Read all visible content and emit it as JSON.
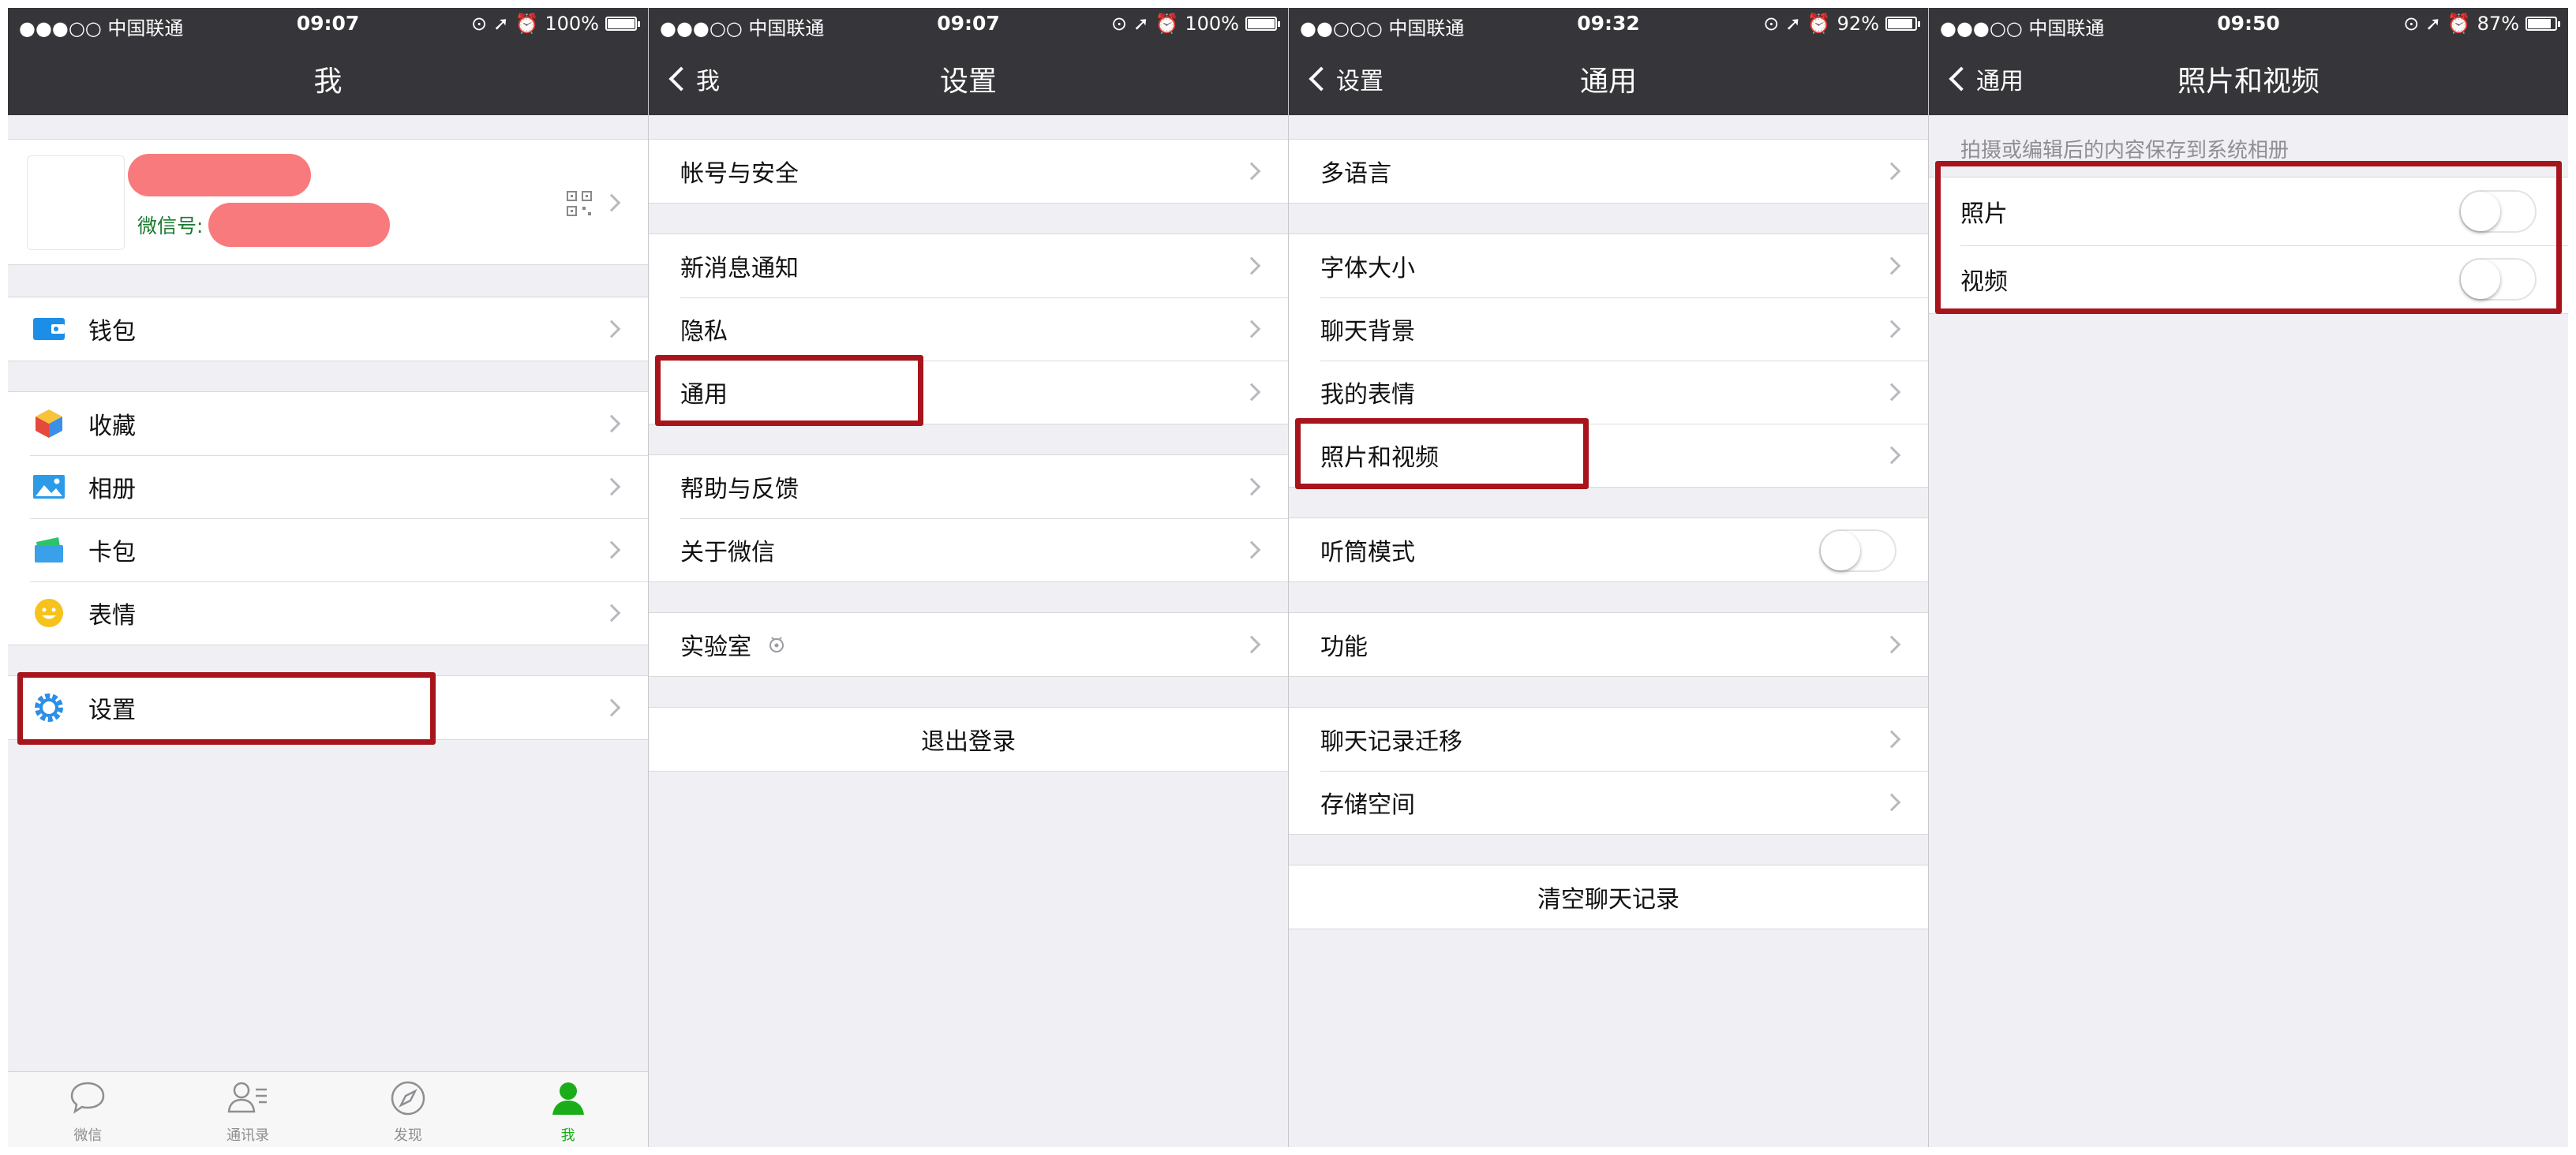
{
  "panels": [
    {
      "status": {
        "carrier": "●●●○○ 中国联通",
        "time": "09:07",
        "battery": "100%",
        "battery_level": 1.0
      },
      "title": "我",
      "profile": {
        "wechat_id_label": "微信号:"
      },
      "items": [
        {
          "label": "钱包",
          "icon": "wallet-icon"
        },
        {
          "label": "收藏",
          "icon": "favorites-icon"
        },
        {
          "label": "相册",
          "icon": "album-icon"
        },
        {
          "label": "卡包",
          "icon": "card-pack-icon"
        },
        {
          "label": "表情",
          "icon": "sticker-icon"
        },
        {
          "label": "设置",
          "icon": "settings-gear-icon"
        }
      ],
      "tabs": [
        {
          "label": "微信",
          "icon": "chat-bubble-icon"
        },
        {
          "label": "通讯录",
          "icon": "contacts-icon"
        },
        {
          "label": "发现",
          "icon": "compass-icon"
        },
        {
          "label": "我",
          "icon": "person-icon"
        }
      ]
    },
    {
      "status": {
        "carrier": "●●●○○ 中国联通",
        "time": "09:07",
        "battery": "100%",
        "battery_level": 1.0
      },
      "back": "我",
      "title": "设置",
      "items": [
        "帐号与安全",
        "新消息通知",
        "隐私",
        "通用",
        "帮助与反馈",
        "关于微信",
        "实验室"
      ],
      "logout": "退出登录"
    },
    {
      "status": {
        "carrier": "●●○○○ 中国联通",
        "time": "09:32",
        "battery": "92%",
        "battery_level": 0.92
      },
      "back": "设置",
      "title": "通用",
      "items": [
        "多语言",
        "字体大小",
        "聊天背景",
        "我的表情",
        "照片和视频",
        "听筒模式",
        "功能",
        "聊天记录迁移",
        "存储空间"
      ],
      "clear": "清空聊天记录",
      "receiver_mode_on": false
    },
    {
      "status": {
        "carrier": "●●●○○ 中国联通",
        "time": "09:50",
        "battery": "87%",
        "battery_level": 0.87
      },
      "back": "通用",
      "title": "照片和视频",
      "section_header": "拍摄或编辑后的内容保存到系统相册",
      "items": [
        {
          "label": "照片",
          "on": false
        },
        {
          "label": "视频",
          "on": false
        }
      ]
    }
  ],
  "colors": {
    "navbar": "#36363a",
    "highlight": "#a8141c",
    "background": "#efeff4",
    "active_tab": "#1aad19"
  }
}
